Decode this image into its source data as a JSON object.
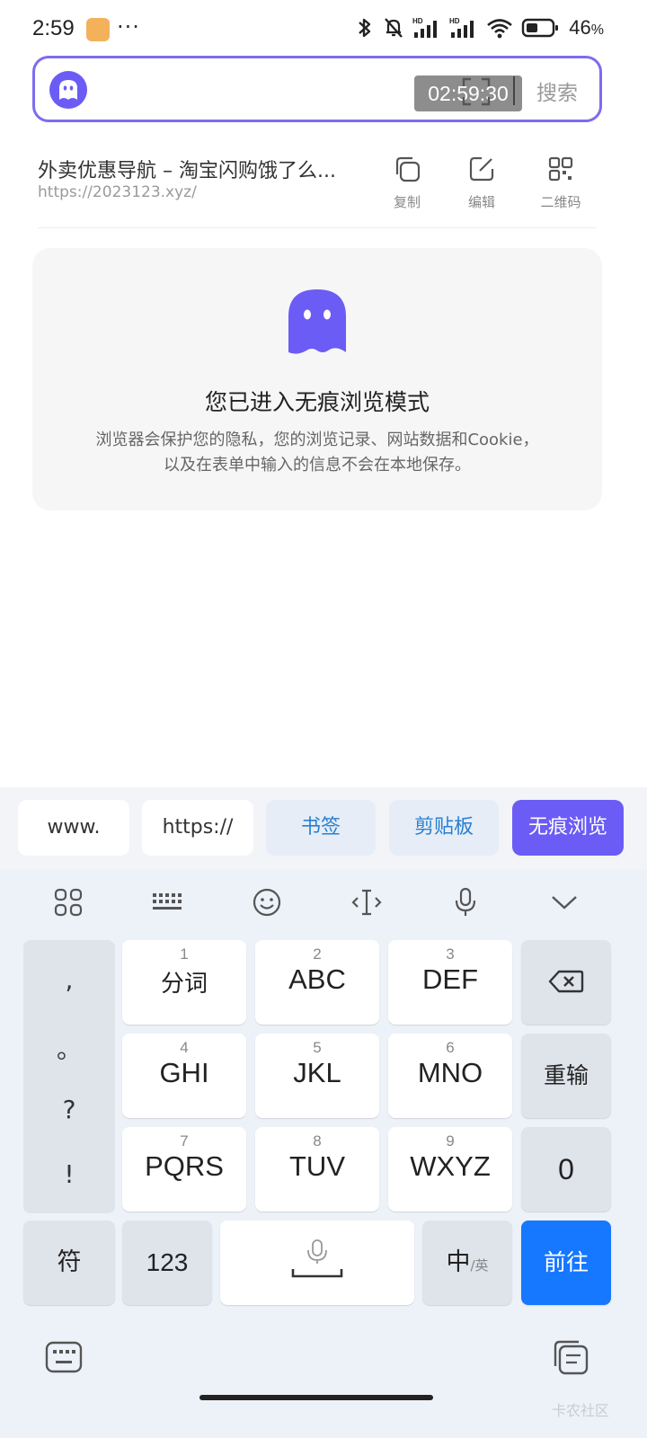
{
  "status": {
    "time": "2:59",
    "dots": "···",
    "battery": "46",
    "battery_unit": "%"
  },
  "search": {
    "timer": "02:59:30",
    "search_label": "搜索"
  },
  "suggestion": {
    "title": "外卖优惠导航 – 淘宝闪购饿了么...",
    "url": "https://2023123.xyz/",
    "copy_label": "复制",
    "edit_label": "编辑",
    "qr_label": "二维码"
  },
  "incognito": {
    "heading": "您已进入无痕浏览模式",
    "desc_line1": "浏览器会保护您的隐私，您的浏览记录、网站数据和Cookie，",
    "desc_line2": "以及在表单中输入的信息不会在本地保存。",
    "accent": "#6b5cf5"
  },
  "quick": {
    "www": "www.",
    "https": "https://",
    "bookmark": "书签",
    "clipboard": "剪贴板",
    "incognito": "无痕浏览"
  },
  "keyboard": {
    "punct": [
      ",",
      "。",
      "?",
      "!"
    ],
    "keys": [
      {
        "num": "1",
        "label": "分词"
      },
      {
        "num": "2",
        "label": "ABC"
      },
      {
        "num": "3",
        "label": "DEF"
      },
      {
        "num": "4",
        "label": "GHI"
      },
      {
        "num": "5",
        "label": "JKL"
      },
      {
        "num": "6",
        "label": "MNO"
      },
      {
        "num": "7",
        "label": "PQRS"
      },
      {
        "num": "8",
        "label": "TUV"
      },
      {
        "num": "9",
        "label": "WXYZ"
      }
    ],
    "reinput": "重输",
    "zero": "0",
    "symbol": "符",
    "numbers": "123",
    "lang_main": "中",
    "lang_sub": "/英",
    "go": "前往",
    "go_color": "#1677ff"
  },
  "watermark": "卡农社区"
}
